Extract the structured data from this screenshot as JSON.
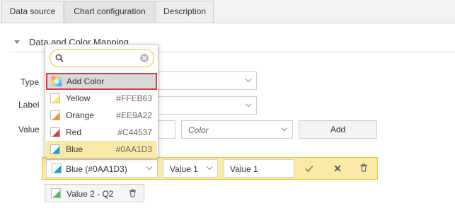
{
  "tabs": [
    {
      "label": "Data source"
    },
    {
      "label": "Chart configuration"
    },
    {
      "label": "Description"
    }
  ],
  "section": {
    "title": "Data and Color Mapping"
  },
  "form": {
    "type_label": "Type",
    "label_label": "Label",
    "value_label": "Value",
    "color_select_placeholder": "Color",
    "add_button": "Add"
  },
  "dropdown": {
    "search_value": "",
    "add_color_label": "Add Color",
    "items": [
      {
        "name": "Yellow",
        "hex": "#FFEB63",
        "color": "#FFEB63"
      },
      {
        "name": "Orange",
        "hex": "#EE9A22",
        "color": "#EE9A22"
      },
      {
        "name": "Red",
        "hex": "#C44537",
        "color": "#C44537"
      },
      {
        "name": "Blue",
        "hex": "#0AA1D3",
        "color": "#0AA1D3"
      }
    ],
    "selected_index": 3
  },
  "mapping_row": {
    "color_value": "Blue (#0AA1D3)",
    "series_select": "Value 1",
    "name_input": "Value 1"
  },
  "existing_chip": {
    "label": "Value 2 - Q2",
    "color": "#5cb85c"
  },
  "colors": {
    "accent": "#f0c23a",
    "highlight": "#fbe9a8",
    "alert_border": "#e03b3b"
  }
}
